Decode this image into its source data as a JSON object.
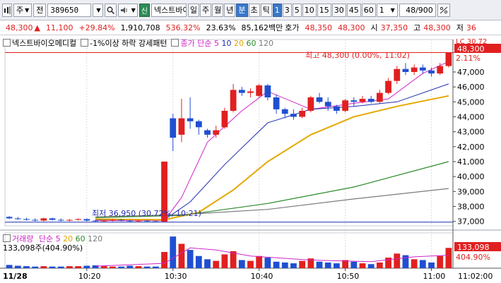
{
  "toolbar": {
    "market": "주",
    "jeon": "전",
    "code": "389650",
    "badge": "신",
    "stock_name": "넥스트바이오메디컬",
    "periods": [
      "일",
      "주",
      "월",
      "년",
      "분",
      "초",
      "틱"
    ],
    "selected_period": "분",
    "intervals": [
      "1",
      "3",
      "5",
      "10",
      "15",
      "30",
      "45",
      "60"
    ],
    "selected_interval": "1",
    "interval_value": "1",
    "page_count": "48/900"
  },
  "info": {
    "price": "48,300",
    "change": "11,100",
    "change_pct": "+29.84%",
    "volume": "1,910,708",
    "vol_ratio": "536.32%",
    "turnover": "23.63%",
    "amount": "85,162백만",
    "quote_label": "호가",
    "ask": "48,350",
    "bid": "48,300",
    "open_label": "시",
    "open": "37,350",
    "high_label": "고",
    "high": "48,300",
    "low_label": "저",
    "low_partial": "36"
  },
  "legend": {
    "name": "넥스트바이오메디컬",
    "pattern": "-1%이상 하락 강세패턴",
    "ma_label": "종가 단순",
    "ma_periods": [
      "5",
      "10",
      "20",
      "60",
      "120"
    ]
  },
  "volume_legend": {
    "label": "거래량",
    "ma_label": "단순",
    "ma_periods": [
      "5",
      "20",
      "60",
      "120"
    ],
    "value_text": "133,098주(404.90%)"
  },
  "annotations": {
    "high": "최고 48,300 (0.00%, 11:02)",
    "low": "최저 36,950 (30.72%, 10:21)",
    "lc_label": "LC 30.72",
    "last_price_label": "48,300",
    "pct_label": "2.11%",
    "vol_last": "133,098",
    "vol_pct": "404.90%"
  },
  "colors": {
    "up": "#e02020",
    "down": "#1f4fd1",
    "ma5": "#d024c8",
    "ma10": "#1e2fb0",
    "ma20": "#e5a800",
    "ma60": "#2d8a2d",
    "ma120": "#7a7a7a"
  },
  "chart_data": {
    "type": "candlestick",
    "x": [
      "11/28",
      "10:20",
      "10:30",
      "10:40",
      "10:50",
      "11:00",
      "11:02:00"
    ],
    "xlim": [
      "10:11",
      "11:02"
    ],
    "y_ticks": [
      37000,
      38000,
      39000,
      40000,
      41000,
      42000,
      43000,
      44000,
      45000,
      46000,
      47000
    ],
    "ylim": [
      36700,
      48700
    ],
    "candles": [
      {
        "t": "10:11",
        "o": 37300,
        "h": 37350,
        "l": 37150,
        "c": 37200
      },
      {
        "t": "10:12",
        "o": 37200,
        "h": 37300,
        "l": 37100,
        "c": 37150
      },
      {
        "t": "10:13",
        "o": 37150,
        "h": 37250,
        "l": 37050,
        "c": 37100
      },
      {
        "t": "10:14",
        "o": 37100,
        "h": 37200,
        "l": 37000,
        "c": 37050
      },
      {
        "t": "10:15",
        "o": 37050,
        "h": 37250,
        "l": 37000,
        "c": 37200
      },
      {
        "t": "10:16",
        "o": 37200,
        "h": 37250,
        "l": 37050,
        "c": 37100
      },
      {
        "t": "10:17",
        "o": 37100,
        "h": 37200,
        "l": 37000,
        "c": 37050
      },
      {
        "t": "10:18",
        "o": 37050,
        "h": 37150,
        "l": 37000,
        "c": 37100
      },
      {
        "t": "10:19",
        "o": 37100,
        "h": 37200,
        "l": 37050,
        "c": 37150
      },
      {
        "t": "10:20",
        "o": 37150,
        "h": 37200,
        "l": 37000,
        "c": 37050
      },
      {
        "t": "10:21",
        "o": 37050,
        "h": 37100,
        "l": 36950,
        "c": 37000
      },
      {
        "t": "10:22",
        "o": 37000,
        "h": 37100,
        "l": 36950,
        "c": 37050
      },
      {
        "t": "10:23",
        "o": 37050,
        "h": 37150,
        "l": 37000,
        "c": 37100
      },
      {
        "t": "10:24",
        "o": 37100,
        "h": 37150,
        "l": 37000,
        "c": 37050
      },
      {
        "t": "10:25",
        "o": 37050,
        "h": 37100,
        "l": 36950,
        "c": 37000
      },
      {
        "t": "10:26",
        "o": 37000,
        "h": 37100,
        "l": 36950,
        "c": 37050
      },
      {
        "t": "10:27",
        "o": 37050,
        "h": 37100,
        "l": 36950,
        "c": 37000
      },
      {
        "t": "10:28",
        "o": 37000,
        "h": 37050,
        "l": 36950,
        "c": 36980
      },
      {
        "t": "10:29",
        "o": 36980,
        "h": 41000,
        "l": 36950,
        "c": 41000
      },
      {
        "t": "10:30",
        "o": 43900,
        "h": 44200,
        "l": 41700,
        "c": 42600
      },
      {
        "t": "10:31",
        "o": 42800,
        "h": 45200,
        "l": 42300,
        "c": 43900
      },
      {
        "t": "10:32",
        "o": 43900,
        "h": 45300,
        "l": 43200,
        "c": 43700
      },
      {
        "t": "10:33",
        "o": 43700,
        "h": 43800,
        "l": 42800,
        "c": 43300
      },
      {
        "t": "10:34",
        "o": 43100,
        "h": 43200,
        "l": 42600,
        "c": 42800
      },
      {
        "t": "10:35",
        "o": 42800,
        "h": 43400,
        "l": 42600,
        "c": 43100
      },
      {
        "t": "10:36",
        "o": 43300,
        "h": 44600,
        "l": 43200,
        "c": 44400
      },
      {
        "t": "10:37",
        "o": 44400,
        "h": 46200,
        "l": 44300,
        "c": 45800
      },
      {
        "t": "10:38",
        "o": 45800,
        "h": 46000,
        "l": 45400,
        "c": 45600
      },
      {
        "t": "10:39",
        "o": 45600,
        "h": 45900,
        "l": 45300,
        "c": 45700
      },
      {
        "t": "10:40",
        "o": 45400,
        "h": 46200,
        "l": 45300,
        "c": 46100
      },
      {
        "t": "10:41",
        "o": 46100,
        "h": 46200,
        "l": 45100,
        "c": 45300
      },
      {
        "t": "10:42",
        "o": 45300,
        "h": 45500,
        "l": 44200,
        "c": 44500
      },
      {
        "t": "10:43",
        "o": 44500,
        "h": 44600,
        "l": 43900,
        "c": 44200
      },
      {
        "t": "10:44",
        "o": 44200,
        "h": 44500,
        "l": 43800,
        "c": 44000
      },
      {
        "t": "10:45",
        "o": 44000,
        "h": 44600,
        "l": 43900,
        "c": 44400
      },
      {
        "t": "10:46",
        "o": 44400,
        "h": 45400,
        "l": 44300,
        "c": 45300
      },
      {
        "t": "10:47",
        "o": 45300,
        "h": 45600,
        "l": 44900,
        "c": 45000
      },
      {
        "t": "10:48",
        "o": 45000,
        "h": 45300,
        "l": 44400,
        "c": 44700
      },
      {
        "t": "10:49",
        "o": 44700,
        "h": 44800,
        "l": 44200,
        "c": 44400
      },
      {
        "t": "10:50",
        "o": 44400,
        "h": 45200,
        "l": 44300,
        "c": 45100
      },
      {
        "t": "10:51",
        "o": 45100,
        "h": 45300,
        "l": 44700,
        "c": 45000
      },
      {
        "t": "10:52",
        "o": 45000,
        "h": 45400,
        "l": 44900,
        "c": 45200
      },
      {
        "t": "10:53",
        "o": 45200,
        "h": 45400,
        "l": 44900,
        "c": 45000
      },
      {
        "t": "10:54",
        "o": 45000,
        "h": 45800,
        "l": 44900,
        "c": 45600
      },
      {
        "t": "10:55",
        "o": 45600,
        "h": 46600,
        "l": 45500,
        "c": 46400
      },
      {
        "t": "10:56",
        "o": 46400,
        "h": 47400,
        "l": 46200,
        "c": 47200
      },
      {
        "t": "10:57",
        "o": 47200,
        "h": 47600,
        "l": 46800,
        "c": 47000
      },
      {
        "t": "10:58",
        "o": 47000,
        "h": 47500,
        "l": 46800,
        "c": 47300
      },
      {
        "t": "10:59",
        "o": 47300,
        "h": 47500,
        "l": 46900,
        "c": 47100
      },
      {
        "t": "11:00",
        "o": 47100,
        "h": 47300,
        "l": 46700,
        "c": 46900
      },
      {
        "t": "11:01",
        "o": 46900,
        "h": 47600,
        "l": 46800,
        "c": 47400
      },
      {
        "t": "11:02",
        "o": 47400,
        "h": 48300,
        "l": 47300,
        "c": 48300
      }
    ],
    "ma_series": [
      {
        "name": "5",
        "anchors": [
          [
            10,
            37050
          ],
          [
            18,
            37050
          ],
          [
            20,
            38600
          ],
          [
            23,
            42300
          ],
          [
            27,
            44400
          ],
          [
            30,
            45700
          ],
          [
            35,
            44500
          ],
          [
            40,
            44900
          ],
          [
            44,
            45200
          ],
          [
            48,
            46900
          ],
          [
            51,
            47700
          ]
        ]
      },
      {
        "name": "10",
        "anchors": [
          [
            10,
            37100
          ],
          [
            18,
            37100
          ],
          [
            21,
            38300
          ],
          [
            25,
            40800
          ],
          [
            30,
            43600
          ],
          [
            35,
            44500
          ],
          [
            40,
            44700
          ],
          [
            45,
            45000
          ],
          [
            51,
            46200
          ]
        ]
      },
      {
        "name": "20",
        "anchors": [
          [
            10,
            37150
          ],
          [
            18,
            37100
          ],
          [
            22,
            37600
          ],
          [
            26,
            39100
          ],
          [
            30,
            41000
          ],
          [
            35,
            42800
          ],
          [
            40,
            44000
          ],
          [
            45,
            44700
          ],
          [
            51,
            45400
          ]
        ]
      },
      {
        "name": "60",
        "anchors": [
          [
            10,
            37250
          ],
          [
            20,
            37400
          ],
          [
            30,
            38200
          ],
          [
            40,
            39300
          ],
          [
            51,
            41000
          ]
        ]
      },
      {
        "name": "120",
        "anchors": [
          [
            10,
            37300
          ],
          [
            20,
            37450
          ],
          [
            30,
            37800
          ],
          [
            40,
            38500
          ],
          [
            51,
            39200
          ]
        ]
      }
    ],
    "volume": {
      "values": [
        8,
        6,
        5,
        4,
        5,
        4,
        4,
        5,
        5,
        6,
        7,
        5,
        4,
        4,
        6,
        5,
        4,
        4,
        40,
        78,
        60,
        45,
        30,
        22,
        18,
        34,
        42,
        20,
        18,
        30,
        26,
        16,
        14,
        12,
        18,
        24,
        16,
        14,
        12,
        20,
        16,
        12,
        10,
        14,
        26,
        36,
        32,
        22,
        20,
        14,
        30,
        50
      ],
      "ma5_anchors": [
        [
          10,
          5
        ],
        [
          18,
          12
        ],
        [
          21,
          50
        ],
        [
          24,
          45
        ],
        [
          28,
          30
        ],
        [
          35,
          20
        ],
        [
          42,
          16
        ],
        [
          47,
          28
        ],
        [
          51,
          32
        ]
      ]
    }
  }
}
